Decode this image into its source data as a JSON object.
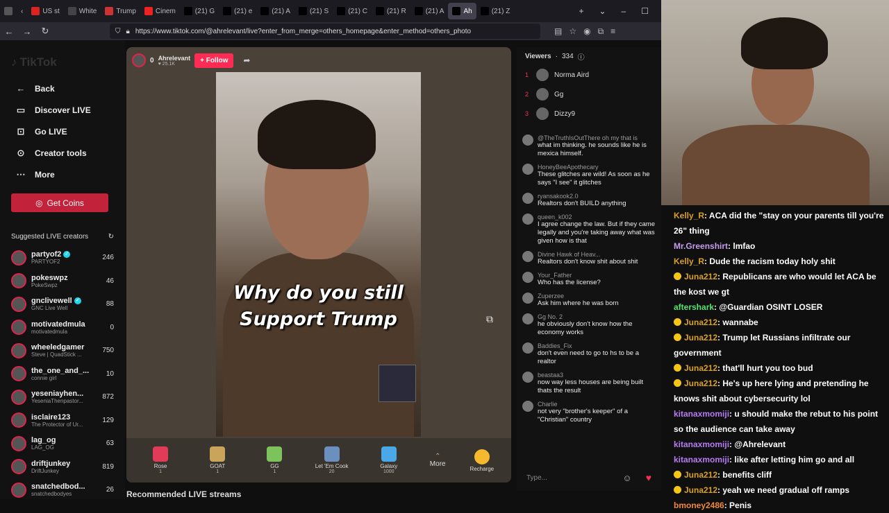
{
  "browser": {
    "tabs": [
      {
        "label": "",
        "color": "#555"
      },
      {
        "label": "US st",
        "color": "#d22"
      },
      {
        "label": "White",
        "color": "#444"
      },
      {
        "label": "Trump",
        "color": "#c33"
      },
      {
        "label": "Cinem",
        "color": "#e22"
      },
      {
        "label": "(21) G",
        "color": "#000"
      },
      {
        "label": "(21) e",
        "color": "#000"
      },
      {
        "label": "(21) A",
        "color": "#000"
      },
      {
        "label": "(21) S",
        "color": "#000"
      },
      {
        "label": "(21) C",
        "color": "#000"
      },
      {
        "label": "(21) R",
        "color": "#000"
      },
      {
        "label": "(21) A",
        "color": "#000"
      },
      {
        "label": "Ah",
        "color": "#000",
        "active": true
      },
      {
        "label": "(21) Z",
        "color": "#000"
      }
    ],
    "url": "https://www.tiktok.com/@ahrelevant/live?enter_from_merge=others_homepage&enter_method=others_photo"
  },
  "sidebar": {
    "logo": "TikTok",
    "back": "Back",
    "nav": [
      {
        "label": "Discover LIVE",
        "icon": "tv-icon"
      },
      {
        "label": "Go LIVE",
        "icon": "camera-icon"
      },
      {
        "label": "Creator tools",
        "icon": "lightbulb-icon"
      },
      {
        "label": "More",
        "icon": "ellipsis-icon"
      }
    ],
    "get_coins": "Get Coins",
    "suggested_title": "Suggested LIVE creators",
    "creators": [
      {
        "name": "partyof2",
        "sub": "PARTYOF2",
        "count": "246",
        "verified": true
      },
      {
        "name": "pokeswpz",
        "sub": "PokeSwpz",
        "count": "46",
        "verified": false
      },
      {
        "name": "gnclivewell",
        "sub": "GNC Live Well",
        "count": "88",
        "verified": true
      },
      {
        "name": "motivatedmula",
        "sub": "motivatedmula",
        "count": "0",
        "verified": false
      },
      {
        "name": "wheeledgamer",
        "sub": "Steve | QuadStick ...",
        "count": "750",
        "verified": false
      },
      {
        "name": "the_one_and_...",
        "sub": "connie girl",
        "count": "10",
        "verified": false
      },
      {
        "name": "yeseniayhen...",
        "sub": "YeseniaThenpastor...",
        "count": "872",
        "verified": false
      },
      {
        "name": "isclaire123",
        "sub": "The Protector of Ur...",
        "count": "129",
        "verified": false
      },
      {
        "name": "lag_og",
        "sub": "LAG_OG",
        "count": "63",
        "verified": false
      },
      {
        "name": "driftjunkey",
        "sub": "DriftJunkey",
        "count": "819",
        "verified": false
      },
      {
        "name": "snatchedbod...",
        "sub": "snatchedbodyes",
        "count": "26",
        "verified": false
      }
    ]
  },
  "stream": {
    "host_name": "Ahrelevant",
    "host_likes": "25.1K",
    "host_count": "0",
    "follow": "+ Follow",
    "caption_line1": "Why do you  still",
    "caption_line2": "Support Trump",
    "gifts": [
      {
        "name": "Rose",
        "price": "1",
        "color": "#e23b57"
      },
      {
        "name": "GOAT",
        "price": "1",
        "color": "#c9a45a"
      },
      {
        "name": "GG",
        "price": "1",
        "color": "#7cc35b"
      },
      {
        "name": "Let 'Em Cook",
        "price": "20",
        "color": "#6b8fbf"
      },
      {
        "name": "Galaxy",
        "price": "1000",
        "color": "#4aa7e8"
      }
    ],
    "more": "More",
    "recharge": "Recharge",
    "recommended": "Recommended LIVE streams"
  },
  "viewers": {
    "title": "Viewers",
    "count": "334",
    "list": [
      {
        "rank": "1",
        "name": "Norma Aird"
      },
      {
        "rank": "2",
        "name": "Gg"
      },
      {
        "rank": "3",
        "name": "Dizzy9"
      }
    ]
  },
  "chat": {
    "messages": [
      {
        "user": "@TheTruthIsOutThere oh my that is",
        "text": "what im thinking. he sounds like he is mexica himself."
      },
      {
        "user": "HoneyBeeApothecary",
        "text": "These glitches are wild! As soon as he says \"I see\" it glitches"
      },
      {
        "user": "ryansakook2.0",
        "text": "Realtors don't BUILD anything"
      },
      {
        "user": "queen_k002",
        "text": "I agree change the law. But if they came legally and you're taking away what was given how is that"
      },
      {
        "user": "Divine Hawk of Heav...",
        "text": "Realtors don't know shit about shit"
      },
      {
        "user": "Your_Father",
        "text": "Who has the license?"
      },
      {
        "user": "Zuperzee",
        "text": "Ask him where he was born"
      },
      {
        "user": "Gg  No. 2",
        "text": "he obviously don't know how the economy works"
      },
      {
        "user": "Baddies_Fix",
        "text": "don't even need to go to hs to be a realtor"
      },
      {
        "user": "beastaa3",
        "text": "now way less houses are being built thats the result"
      },
      {
        "user": "Charlie",
        "text": "not very \"brother's keeper\" of a \"Christian\" country"
      }
    ],
    "placeholder": "Type..."
  },
  "twitch_chat": [
    {
      "user": "Kelly_R",
      "color": "#d8a024",
      "text": ": ACA did the \"stay on your parents till you're 26\" thing",
      "badge": false
    },
    {
      "user": "Mr.Greenshirt",
      "color": "#c79df0",
      "text": ": lmfao",
      "badge": false
    },
    {
      "user": "Kelly_R",
      "color": "#d8a024",
      "text": ": Dude the racism today holy shit",
      "badge": false
    },
    {
      "user": "Juna212",
      "color": "#d8a024",
      "text": ": Republicans are who would let ACA be the kost we gt",
      "badge": true
    },
    {
      "user": "aftershark",
      "color": "#55e36f",
      "text": ": @Guardian OSINT LOSER",
      "badge": false
    },
    {
      "user": "Juna212",
      "color": "#d8a024",
      "text": ": wannabe",
      "badge": true
    },
    {
      "user": "Juna212",
      "color": "#d8a024",
      "text": ": Trump let Russians infiltrate our government",
      "badge": true
    },
    {
      "user": "Juna212",
      "color": "#d8a024",
      "text": ": that'll hurt you too bud",
      "badge": true
    },
    {
      "user": "Juna212",
      "color": "#d8a024",
      "text": ": He's up here lying and pretending he knows shit about cybersecurity lol",
      "badge": true
    },
    {
      "user": "kitanaxmomiji",
      "color": "#b77cf2",
      "text": ": u should make the rebut to his point so the audience can take away",
      "badge": false
    },
    {
      "user": "kitanaxmomiji",
      "color": "#b77cf2",
      "text": ": @Ahrelevant",
      "badge": false
    },
    {
      "user": "kitanaxmomiji",
      "color": "#b77cf2",
      "text": ": like after letting him go and all",
      "badge": false
    },
    {
      "user": "Juna212",
      "color": "#d8a024",
      "text": ": benefits cliff",
      "badge": true
    },
    {
      "user": "Juna212",
      "color": "#d8a024",
      "text": ": yeah we need gradual off ramps",
      "badge": true
    },
    {
      "user": "bmoney2486",
      "color": "#f08a3a",
      "text": ": Penis",
      "badge": false
    }
  ]
}
